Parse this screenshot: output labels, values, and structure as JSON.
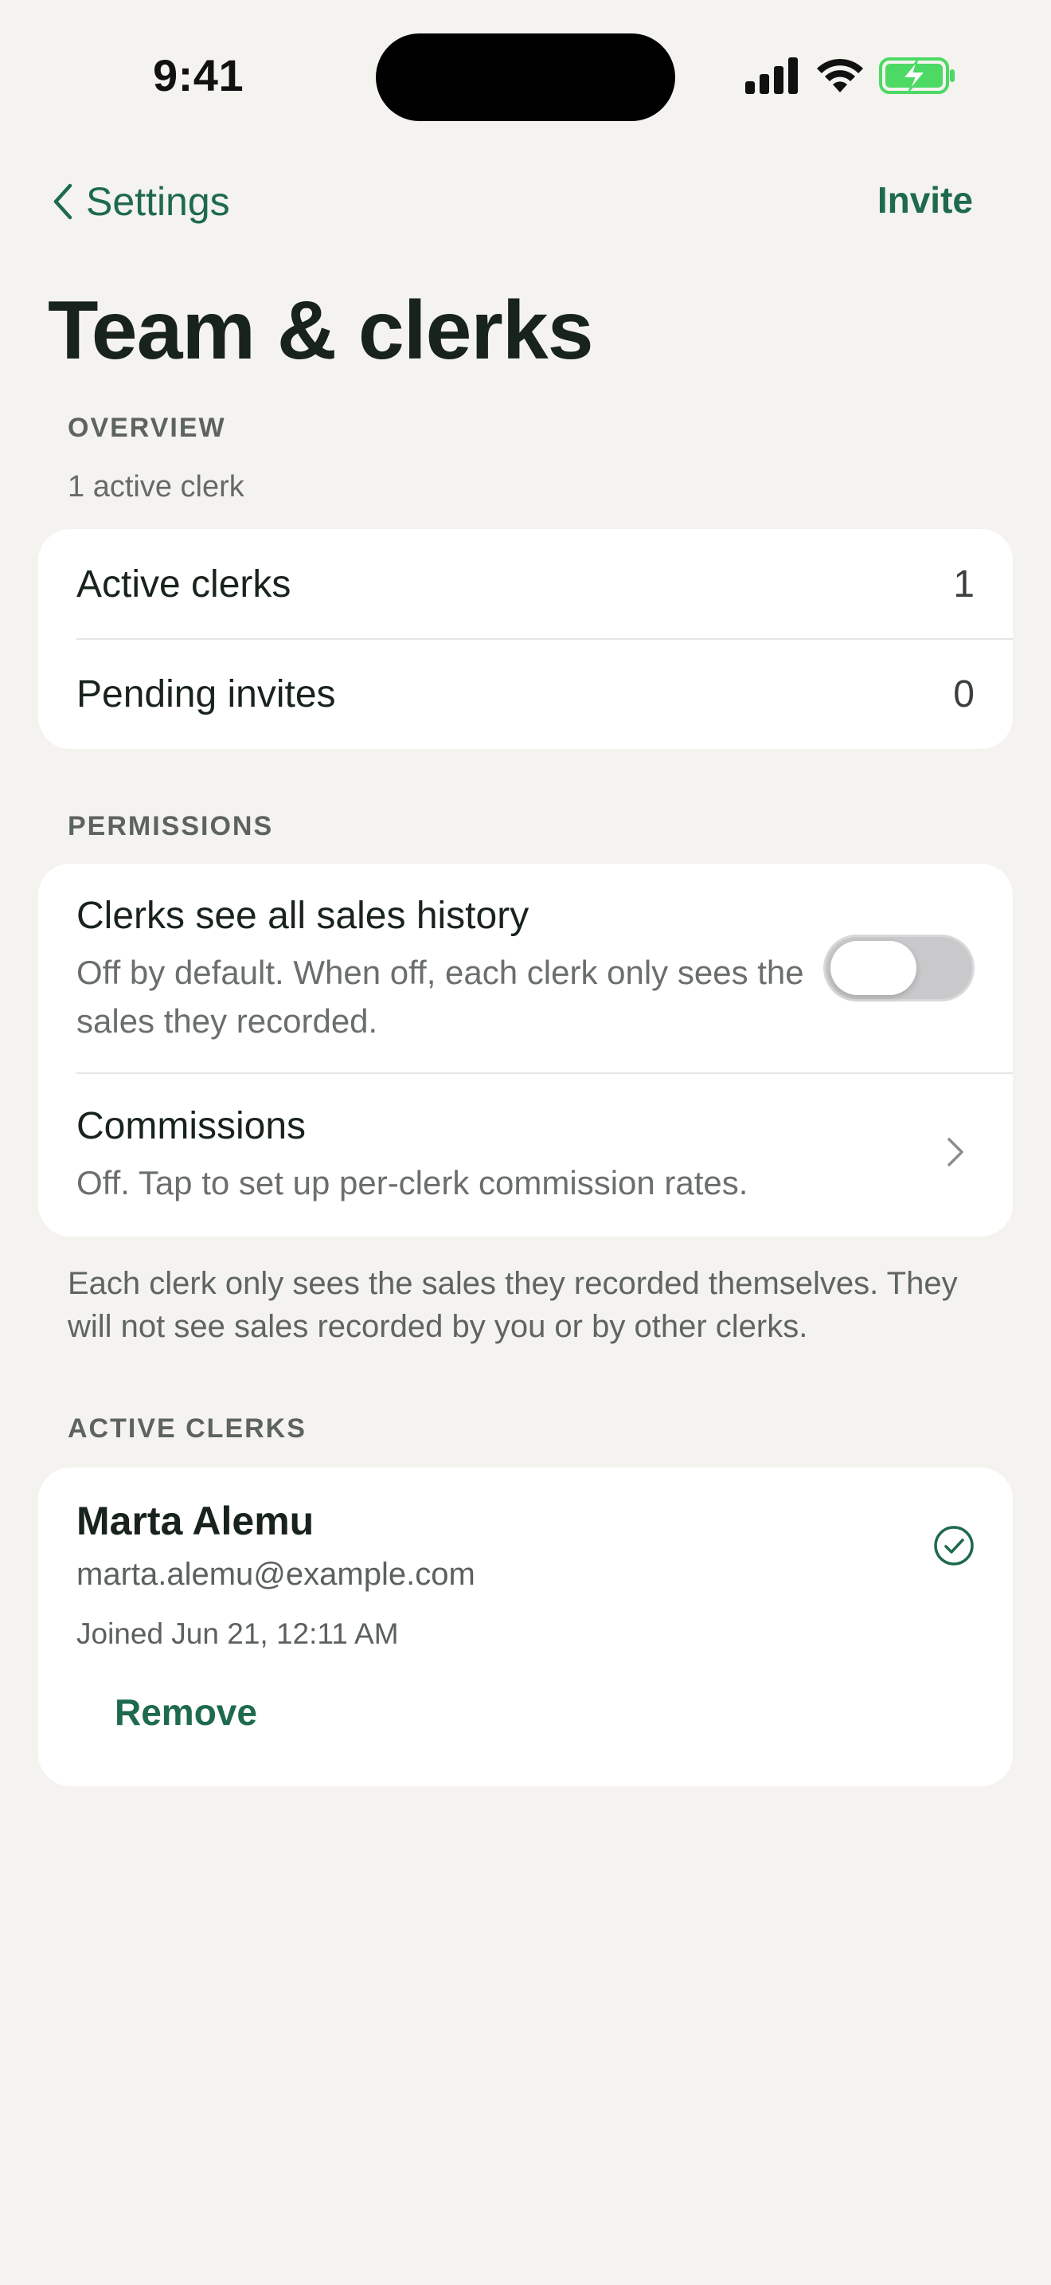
{
  "status_bar": {
    "time": "9:41",
    "icons": [
      "cellular-signal-icon",
      "wifi-icon",
      "battery-charging-icon"
    ]
  },
  "nav": {
    "back_label": "Settings",
    "action_label": "Invite"
  },
  "page": {
    "title": "Team & clerks"
  },
  "overview": {
    "header": "OVERVIEW",
    "subtitle": "1 active clerk",
    "rows": [
      {
        "label": "Active clerks",
        "value": "1"
      },
      {
        "label": "Pending invites",
        "value": "0"
      }
    ]
  },
  "permissions": {
    "header": "PERMISSIONS",
    "sales_history": {
      "title": "Clerks see all sales history",
      "description": "Off by default. When off, each clerk only sees the sales they recorded.",
      "enabled": false
    },
    "commissions": {
      "title": "Commissions",
      "description": "Off. Tap to set up per-clerk commission rates."
    },
    "footnote": "Each clerk only sees the sales they recorded themselves. They will not see sales recorded by you or by other clerks."
  },
  "active_clerks": {
    "header": "ACTIVE CLERKS",
    "items": [
      {
        "name": "Marta Alemu",
        "email": "marta.alemu@example.com",
        "joined": "Joined Jun 21, 12:11 AM",
        "action": "Remove"
      }
    ]
  },
  "colors": {
    "accent": "#1e6a4c",
    "background": "#f4f3ef",
    "card": "#ffffff",
    "battery": "#4cd964"
  }
}
